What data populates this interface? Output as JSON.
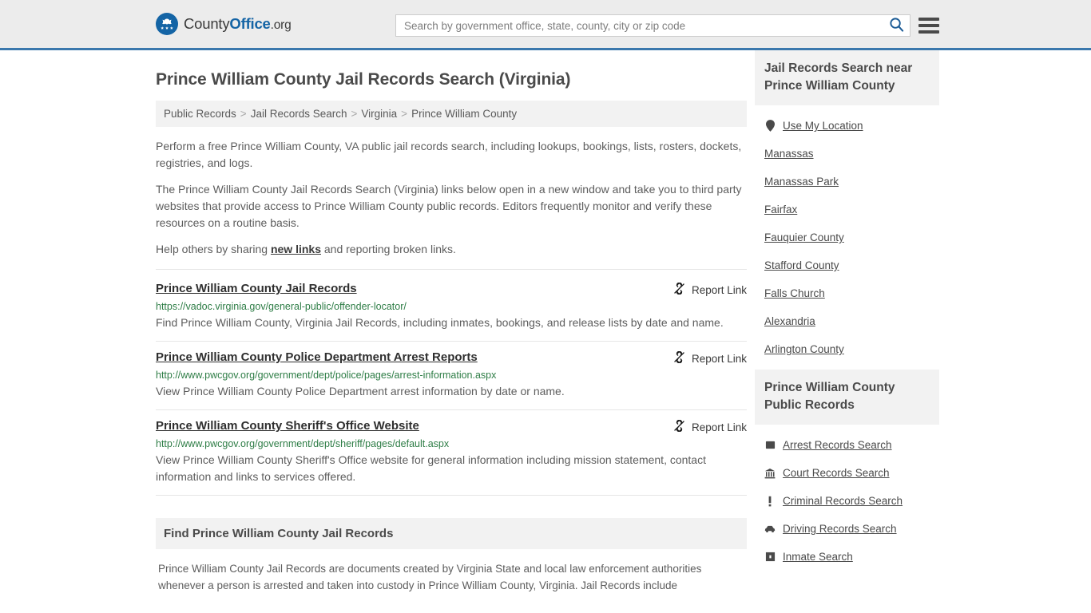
{
  "header": {
    "brand": {
      "part1": "County",
      "part2": "Office",
      "part3": ".org",
      "logo_icon": "eagle-stars-logo"
    },
    "search": {
      "placeholder": "Search by government office, state, county, city or zip code",
      "value": "",
      "icon": "search-icon"
    },
    "menu": {
      "icon": "hamburger-menu-icon",
      "label": "Menu"
    },
    "accent_color": "#3b78ad",
    "background_color": "#ececec"
  },
  "page": {
    "title": "Prince William County Jail Records Search (Virginia)"
  },
  "breadcrumb": {
    "separator": ">",
    "items": [
      {
        "label": "Public Records"
      },
      {
        "label": "Jail Records Search"
      },
      {
        "label": "Virginia"
      },
      {
        "label": "Prince William County"
      }
    ]
  },
  "intro": {
    "p1": "Perform a free Prince William County, VA public jail records search, including lookups, bookings, lists, rosters, dockets, registries, and logs.",
    "p2": "The Prince William County Jail Records Search (Virginia) links below open in a new window and take you to third party websites that provide access to Prince William County public records. Editors frequently monitor and verify these resources on a routine basis.",
    "p3_before": "Help others by sharing ",
    "p3_link": "new links",
    "p3_after": " and reporting broken links."
  },
  "results": {
    "report_label": "Report Link",
    "report_icon": "broken-link-icon",
    "items": [
      {
        "title": "Prince William County Jail Records",
        "url": "https://vadoc.virginia.gov/general-public/offender-locator/",
        "description": "Find Prince William County, Virginia Jail Records, including inmates, bookings, and release lists by date and name."
      },
      {
        "title": "Prince William County Police Department Arrest Reports",
        "url": "http://www.pwcgov.org/government/dept/police/pages/arrest-information.aspx",
        "description": "View Prince William County Police Department arrest information by date or name."
      },
      {
        "title": "Prince William County Sheriff's Office Website",
        "url": "http://www.pwcgov.org/government/dept/sheriff/pages/default.aspx",
        "description": "View Prince William County Sheriff's Office website for general information including mission statement, contact information and links to services offered."
      }
    ]
  },
  "find_section": {
    "heading": "Find Prince William County Jail Records",
    "body": "Prince William County Jail Records are documents created by Virginia State and local law enforcement authorities whenever a person is arrested and taken into custody in Prince William County, Virginia. Jail Records include"
  },
  "sidebar": {
    "nearby": {
      "heading": "Jail Records Search near Prince William County",
      "items": [
        {
          "label": "Use My Location",
          "icon": "map-pin-icon"
        },
        {
          "label": "Manassas",
          "icon": ""
        },
        {
          "label": "Manassas Park",
          "icon": ""
        },
        {
          "label": "Fairfax",
          "icon": ""
        },
        {
          "label": "Fauquier County",
          "icon": ""
        },
        {
          "label": "Stafford County",
          "icon": ""
        },
        {
          "label": "Falls Church",
          "icon": ""
        },
        {
          "label": "Alexandria",
          "icon": ""
        },
        {
          "label": "Arlington County",
          "icon": ""
        }
      ]
    },
    "public_records": {
      "heading": "Prince William County Public Records",
      "items": [
        {
          "label": "Arrest Records Search",
          "icon": "fingerprint-icon"
        },
        {
          "label": "Court Records Search",
          "icon": "courthouse-icon"
        },
        {
          "label": "Criminal Records Search",
          "icon": "exclamation-icon"
        },
        {
          "label": "Driving Records Search",
          "icon": "car-icon"
        },
        {
          "label": "Inmate Search",
          "icon": "jail-door-icon"
        }
      ]
    }
  }
}
